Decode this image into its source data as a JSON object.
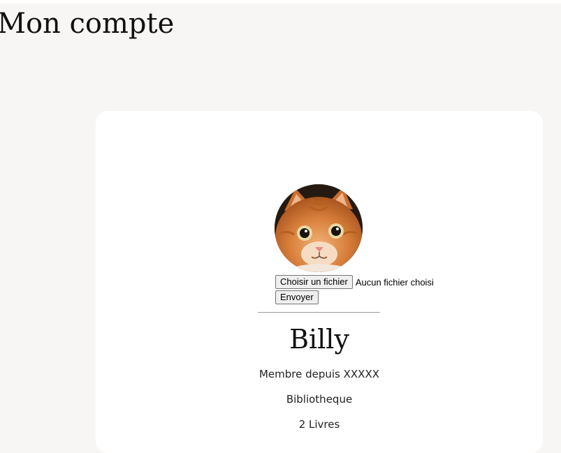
{
  "page": {
    "title": "Mon compte"
  },
  "profile": {
    "avatar_icon": "cat-photo",
    "upload": {
      "choose_label": "Choisir un fichier",
      "status": "Aucun fichier choisi",
      "submit_label": "Envoyer"
    },
    "username": "Billy",
    "member_since": "Membre depuis XXXXX",
    "library_link": "Bibliotheque",
    "books_count": "2 Livres"
  },
  "colors": {
    "background": "#f7f6f4",
    "card": "#ffffff",
    "text": "#111111"
  }
}
